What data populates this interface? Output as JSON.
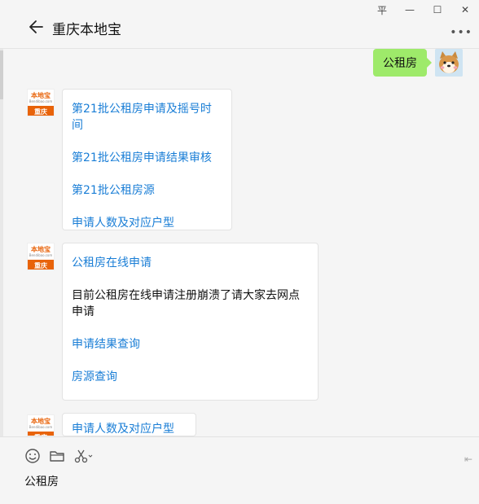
{
  "window": {
    "controls": {
      "pin": "平",
      "minimize": "—",
      "maximize": "☐",
      "close": "✕"
    }
  },
  "header": {
    "title": "重庆本地宝",
    "more": "•••"
  },
  "messages": {
    "outgoing_text": "公租房",
    "bot": {
      "logo_name": "本地宝",
      "logo_url": "Bendibao.com",
      "logo_city": "重庆"
    },
    "card1": {
      "links": [
        "第21批公租房申请及摇号时间",
        "第21批公租房申请结果审核",
        "第21批公租房源",
        "申请人数及对应户型"
      ]
    },
    "card2": {
      "link1": "公租房在线申请",
      "text": "目前公租房在线申请注册崩溃了请大家去网点申请",
      "link2": "申请结果查询",
      "link3": "房源查询"
    },
    "card3": {
      "link1": "申请人数及对应户型"
    }
  },
  "input": {
    "value": "公租房",
    "send_icon": "⇤"
  },
  "colors": {
    "link": "#1a7ed6",
    "outgoing_bubble": "#9eea6a",
    "brand_orange": "#e8630a"
  }
}
